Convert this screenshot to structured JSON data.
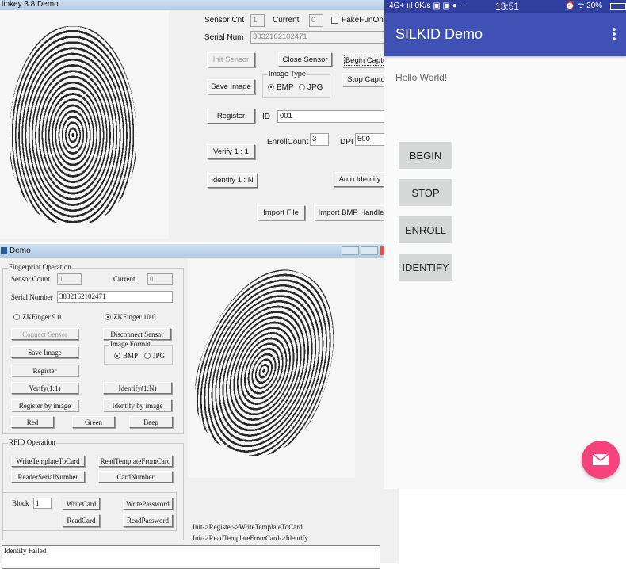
{
  "top_window": {
    "title": "liokey 3.8 Demo",
    "sensor_cnt_label": "Sensor Cnt",
    "sensor_cnt_value": "1",
    "current_label": "Current",
    "current_value": "0",
    "fake_fun_label": "FakeFunOn",
    "serial_label": "Serial Num",
    "serial_value": "3832162102471",
    "init_sensor": "Init Sensor",
    "close_sensor": "Close  Sensor",
    "begin_capture": "Begin Captu",
    "stop_capture": "Stop Captu",
    "save_image": "Save Image",
    "image_type_label": "Image Type",
    "bmp": "BMP",
    "jpg": "JPG",
    "register": "Register",
    "id_label": "ID",
    "id_value": "001",
    "enroll_count_label": "EnrollCount",
    "enroll_count_value": "3",
    "dpi_label": "DPI",
    "dpi_value": "500",
    "verify": "Verify 1 : 1",
    "identify": "Identify 1 : N",
    "auto_identify": "Auto Identify",
    "import_file": "Import File",
    "import_bmp": "Import BMP Handle"
  },
  "bottom_window": {
    "title": "Demo",
    "fp_group": "Fingerprint Operation",
    "sensor_count_label": "Sensor Count",
    "sensor_count_value": "1",
    "current_label": "Current",
    "current_value": "0",
    "serial_label": "Serial Number",
    "serial_value": "3832162102471",
    "zk9": "ZKFinger 9.0",
    "zk10": "ZKFinger 10.0",
    "connect": "Connect Sensor",
    "disconnect": "Disconnect Sensor",
    "save_image": "Save Image",
    "image_format": "Image Format",
    "bmp": "BMP",
    "jpg": "JPG",
    "register": "Register",
    "verify": "Verify(1:1)",
    "identify": "Identify(1:N)",
    "register_by_image": "Register by image",
    "identify_by_image": "Identify by image",
    "red": "Red",
    "green": "Green",
    "beep": "Beep",
    "rfid_group": "RFID Operation",
    "write_template": "WriteTemplateToCard",
    "read_template": "ReadTemplateFromCard",
    "reader_serial": "ReaderSerialNumber",
    "card_number": "CardNumber",
    "block_label": "Block",
    "block_value": "1",
    "write_card": "WriteCard",
    "write_password": "WritePassword",
    "read_card": "ReadCard",
    "read_password": "ReadPassword",
    "hint1": "Init->Register->WriteTemplateToCard",
    "hint2": "Init->ReadTemplateFromCard->Identify",
    "log": "Identify Failed"
  },
  "phone": {
    "status_left": "4G+ ııl 0K/s ▣ ▣ ● ···",
    "time": "13:51",
    "status_right": "⏰ ᯤ 20%",
    "app_title": "SILKID Demo",
    "hello": "Hello World!",
    "buttons": [
      "BEGIN",
      "STOP",
      "ENROLL",
      "IDENTIFY"
    ],
    "toolbar_color": "#3f51b5",
    "fab_color": "#f7437c"
  }
}
